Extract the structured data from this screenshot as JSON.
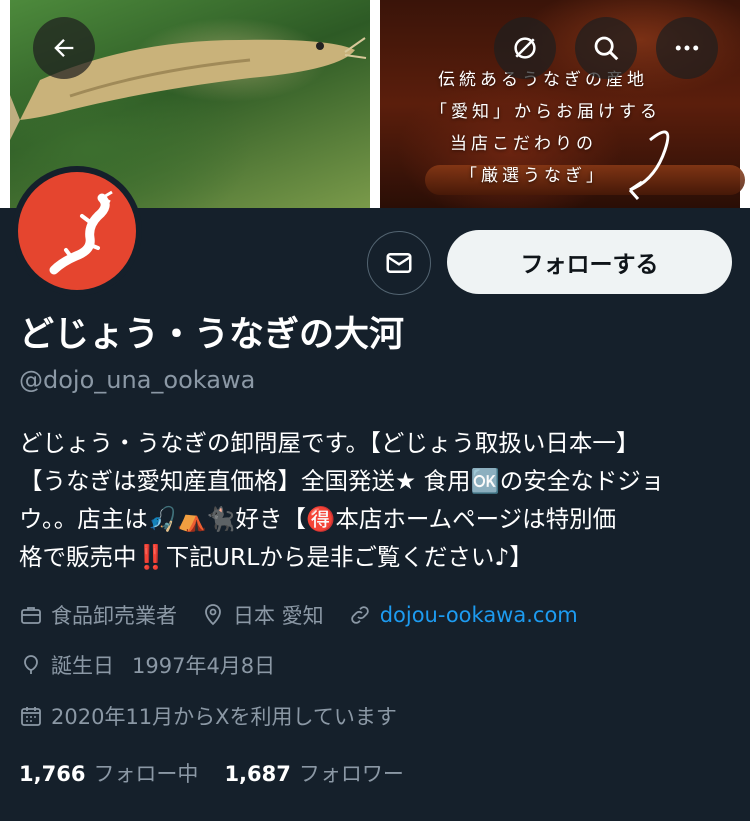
{
  "header": {
    "banner_text": [
      "伝統あるうなぎの産地",
      "「愛知」からお届けする",
      "当店こだわりの",
      "「厳選うなぎ」"
    ]
  },
  "actions": {
    "follow_label": "フォローする"
  },
  "profile": {
    "display_name": "どじょう・うなぎの大河",
    "handle": "@dojo_una_ookawa",
    "bio_lines": [
      "どじょう・うなぎの卸問屋です。【どじょう取扱い日本一】",
      "【うなぎは愛知産直価格】全国発送★ 食用🆗の安全なドジョ",
      "ウ。。店主は🎣⛺🐈‍⬛好き【🉐本店ホームページは特別価",
      "格で販売中‼️下記URLから是非ご覧ください♪】"
    ],
    "category": "食品卸売業者",
    "location": "日本 愛知",
    "website": "dojou-ookawa.com",
    "birthday_label": "誕生日",
    "birthday": "1997年4月8日",
    "joined": "2020年11月からXを利用しています"
  },
  "stats": {
    "following_count": "1,766",
    "following_label": "フォロー中",
    "followers_count": "1,687",
    "followers_label": "フォロワー"
  },
  "colors": {
    "background": "#15202b",
    "secondary_text": "#8b98a5",
    "link": "#1d9bf0",
    "avatar": "#e5452f",
    "button_bg": "#eff3f4"
  }
}
